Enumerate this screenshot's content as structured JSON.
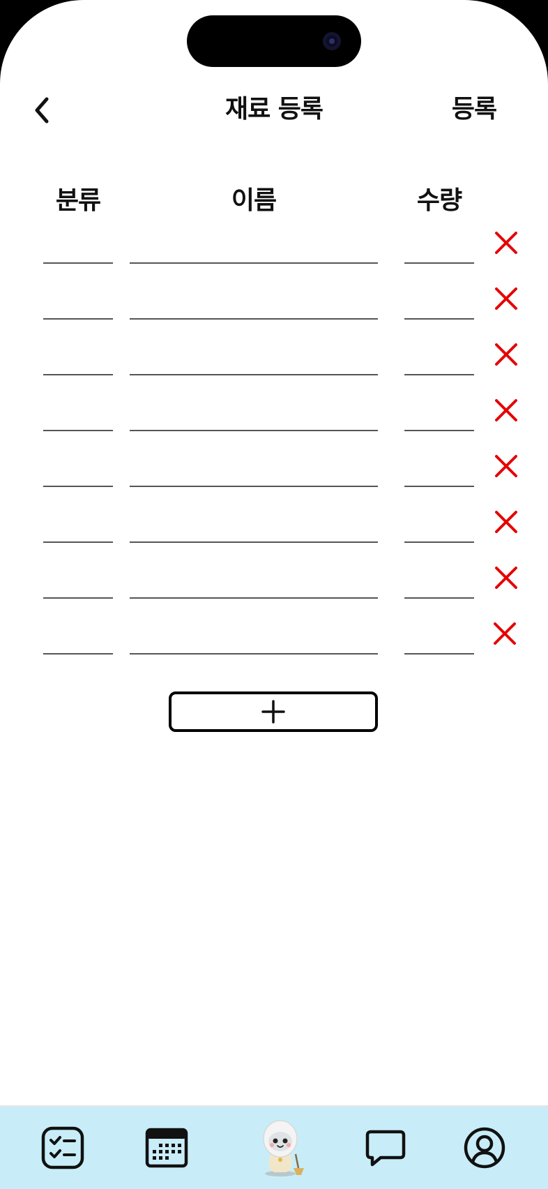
{
  "header": {
    "title": "재료 등록",
    "submit_label": "등록",
    "back_icon": "chevron-left-icon"
  },
  "columns": {
    "category": "분류",
    "name": "이름",
    "quantity": "수량"
  },
  "rows": [
    {
      "category": "",
      "name": "",
      "quantity": ""
    },
    {
      "category": "",
      "name": "",
      "quantity": ""
    },
    {
      "category": "",
      "name": "",
      "quantity": ""
    },
    {
      "category": "",
      "name": "",
      "quantity": ""
    },
    {
      "category": "",
      "name": "",
      "quantity": ""
    },
    {
      "category": "",
      "name": "",
      "quantity": ""
    },
    {
      "category": "",
      "name": "",
      "quantity": ""
    },
    {
      "category": "",
      "name": "",
      "quantity": ""
    }
  ],
  "add_button_icon": "plus-icon",
  "delete_icon": "close-icon",
  "colors": {
    "delete": "#e60000",
    "nav_background": "#c8edf9",
    "text": "#111111"
  },
  "bottom_nav": [
    {
      "icon": "checklist-icon"
    },
    {
      "icon": "calendar-icon"
    },
    {
      "icon": "robot-mascot-icon"
    },
    {
      "icon": "chat-bubble-icon"
    },
    {
      "icon": "profile-icon"
    }
  ]
}
